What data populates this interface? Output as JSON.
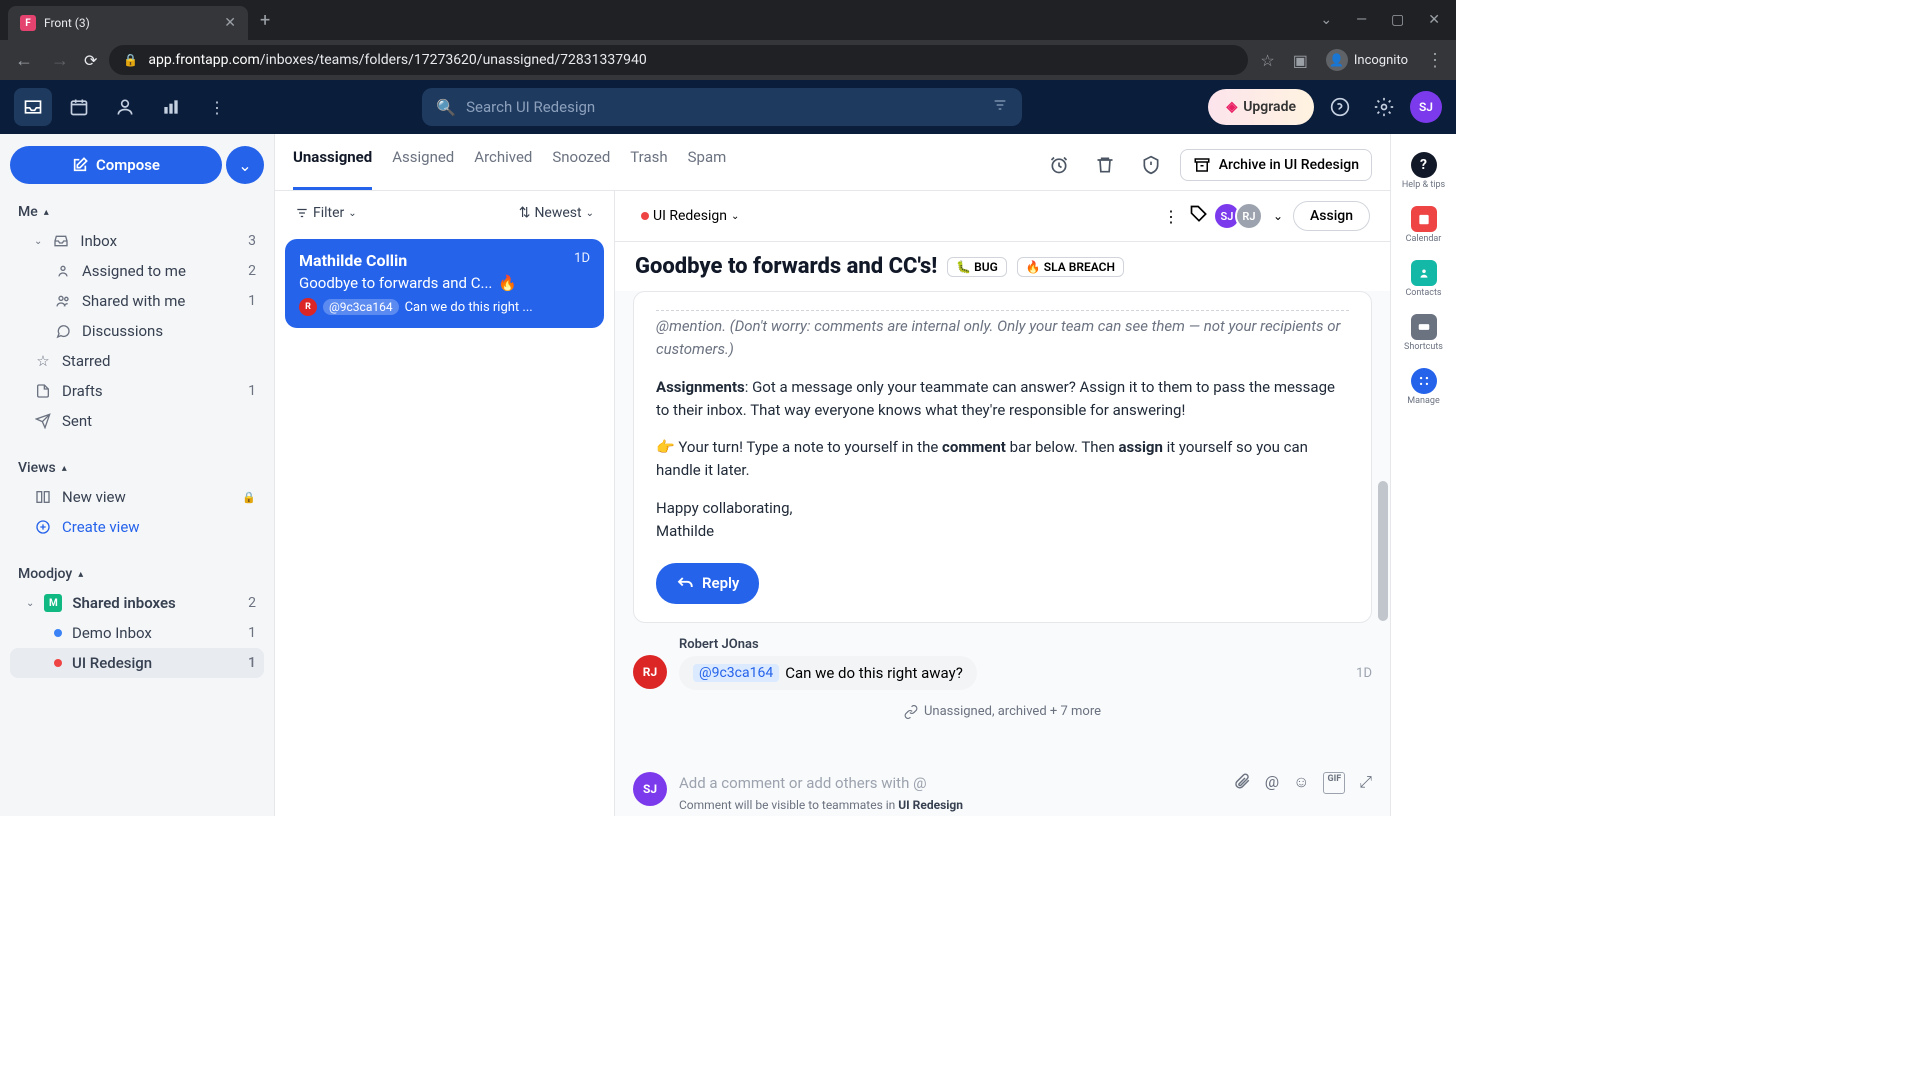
{
  "browser": {
    "tab_title": "Front (3)",
    "url_domain": "app.frontapp.com",
    "url_path": "/inboxes/teams/folders/17273620/unassigned/72831337940",
    "incognito": "Incognito"
  },
  "header": {
    "search_placeholder": "Search UI Redesign",
    "upgrade": "Upgrade"
  },
  "compose": "Compose",
  "sidebar": {
    "me": "Me",
    "inbox": {
      "label": "Inbox",
      "count": "3"
    },
    "assigned": {
      "label": "Assigned to me",
      "count": "2"
    },
    "shared": {
      "label": "Shared with me",
      "count": "1"
    },
    "discussions": "Discussions",
    "starred": "Starred",
    "drafts": {
      "label": "Drafts",
      "count": "1"
    },
    "sent": "Sent",
    "views": "Views",
    "new_view": "New view",
    "create_view": "Create view",
    "moodjoy": "Moodjoy",
    "shared_inboxes": {
      "label": "Shared inboxes",
      "count": "2"
    },
    "demo_inbox": {
      "label": "Demo Inbox",
      "count": "1"
    },
    "ui_redesign": {
      "label": "UI Redesign",
      "count": "1"
    }
  },
  "tabs": {
    "unassigned": "Unassigned",
    "assigned": "Assigned",
    "archived": "Archived",
    "snoozed": "Snoozed",
    "trash": "Trash",
    "spam": "Spam"
  },
  "filter_row": {
    "filter": "Filter",
    "newest": "Newest",
    "ui_redesign": "UI Redesign"
  },
  "convo": {
    "sender": "Mathilde Collin",
    "time": "1D",
    "subject": "Goodbye to forwards and C...",
    "fire": "🔥",
    "avatar": "R",
    "mention": "@9c3ca164",
    "preview": "Can we do this right ..."
  },
  "toolbar": {
    "archive_label": "Archive in UI Redesign",
    "assign": "Assign"
  },
  "subject": {
    "title": "Goodbye to forwards and CC's!",
    "tag_bug": "🐛 BUG",
    "tag_sla": "🔥 SLA BREACH"
  },
  "body": {
    "truncated": "@mention. (Don't worry: comments are internal only. Only your team can see them — not your recipients or customers.)",
    "assignments_label": "Assignments",
    "assignments_text": ": Got a message only your teammate can answer? Assign it to them to pass the message to their inbox. That way everyone knows what they're responsible for answering!",
    "turn_prefix": "👉 Your turn! Type a note to yourself in the ",
    "turn_bold1": "comment",
    "turn_mid": " bar below. Then ",
    "turn_bold2": "assign",
    "turn_suffix": " it yourself so you can handle it later.",
    "closing": "Happy collaborating,",
    "signature": "Mathilde",
    "reply": "Reply"
  },
  "comment": {
    "author": "Robert JOnas",
    "avatar": "RJ",
    "mention": "@9c3ca164",
    "text": "Can we do this right away?",
    "time": "1D"
  },
  "activity": "Unassigned, archived + 7 more",
  "composer": {
    "avatar": "SJ",
    "placeholder": "Add a comment or add others with @",
    "hint_prefix": "Comment will be visible to teammates in ",
    "hint_bold": "UI Redesign"
  },
  "rail": {
    "help": "Help & tips",
    "calendar": "Calendar",
    "contacts": "Contacts",
    "shortcuts": "Shortcuts",
    "manage": "Manage"
  }
}
